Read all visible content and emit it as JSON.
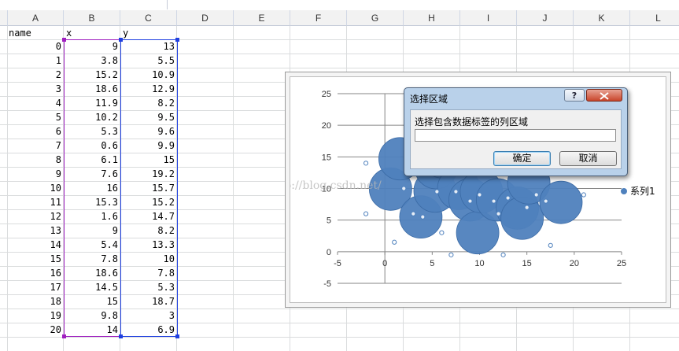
{
  "columns": [
    "A",
    "B",
    "C",
    "D",
    "E",
    "F",
    "G",
    "H",
    "I",
    "J",
    "K",
    "L"
  ],
  "headers": {
    "name": "name",
    "x": "x",
    "y": "y"
  },
  "rows": [
    {
      "name": "0",
      "x": "9",
      "y": "13"
    },
    {
      "name": "1",
      "x": "3.8",
      "y": "5.5"
    },
    {
      "name": "2",
      "x": "15.2",
      "y": "10.9"
    },
    {
      "name": "3",
      "x": "18.6",
      "y": "12.9"
    },
    {
      "name": "4",
      "x": "11.9",
      "y": "8.2"
    },
    {
      "name": "5",
      "x": "10.2",
      "y": "9.5"
    },
    {
      "name": "6",
      "x": "5.3",
      "y": "9.6"
    },
    {
      "name": "7",
      "x": "0.6",
      "y": "9.9"
    },
    {
      "name": "8",
      "x": "6.1",
      "y": "15"
    },
    {
      "name": "9",
      "x": "7.6",
      "y": "19.2"
    },
    {
      "name": "10",
      "x": "16",
      "y": "15.7"
    },
    {
      "name": "11",
      "x": "15.3",
      "y": "15.2"
    },
    {
      "name": "12",
      "x": "1.6",
      "y": "14.7"
    },
    {
      "name": "13",
      "x": "9",
      "y": "8.2"
    },
    {
      "name": "14",
      "x": "5.4",
      "y": "13.3"
    },
    {
      "name": "15",
      "x": "7.8",
      "y": "10"
    },
    {
      "name": "16",
      "x": "18.6",
      "y": "7.8"
    },
    {
      "name": "17",
      "x": "14.5",
      "y": "5.3"
    },
    {
      "name": "18",
      "x": "15",
      "y": "18.7"
    },
    {
      "name": "19",
      "x": "9.8",
      "y": "3"
    },
    {
      "name": "20",
      "x": "14",
      "y": "6.9"
    }
  ],
  "chart_data": {
    "type": "scatter",
    "xlim": [
      -5,
      25
    ],
    "ylim": [
      -5,
      25
    ],
    "xticks": [
      "-5",
      "0",
      "5",
      "10",
      "15",
      "20",
      "25"
    ],
    "yticks": [
      "-5",
      "0",
      "5",
      "10",
      "15",
      "20",
      "25"
    ],
    "series": [
      {
        "name": "系列1",
        "color": "#4f81bd"
      }
    ],
    "legend_position": "right",
    "watermark": "http://blog.csdn.net/",
    "bubbles": [
      [
        0.6,
        9.9
      ],
      [
        1.6,
        14.7
      ],
      [
        3.8,
        5.5
      ],
      [
        5.3,
        9.6
      ],
      [
        5.4,
        13.3
      ],
      [
        6.1,
        15
      ],
      [
        7.8,
        10
      ],
      [
        9,
        8.2
      ],
      [
        9.8,
        3
      ],
      [
        10.2,
        9.5
      ],
      [
        11.9,
        8.2
      ],
      [
        14,
        6.9
      ],
      [
        14.5,
        5.3
      ],
      [
        15.2,
        10.9
      ],
      [
        18.6,
        7.8
      ]
    ],
    "small_points": [
      [
        -2,
        14
      ],
      [
        -2,
        6
      ],
      [
        1,
        1.5
      ],
      [
        2,
        10
      ],
      [
        3,
        6
      ],
      [
        4,
        5.5
      ],
      [
        5.5,
        9.5
      ],
      [
        6,
        3
      ],
      [
        7,
        -0.5
      ],
      [
        7.5,
        9.5
      ],
      [
        9,
        8
      ],
      [
        10,
        9
      ],
      [
        11.5,
        8
      ],
      [
        12,
        6
      ],
      [
        12.5,
        -0.5
      ],
      [
        13,
        8.5
      ],
      [
        15,
        7
      ],
      [
        16,
        9
      ],
      [
        17,
        8
      ],
      [
        17.5,
        1
      ],
      [
        21,
        9
      ]
    ]
  },
  "dialog": {
    "title": "选择区域",
    "help": "?",
    "label": "选择包含数据标签的列区域",
    "input_value": "",
    "ok": "确定",
    "cancel": "取消"
  }
}
